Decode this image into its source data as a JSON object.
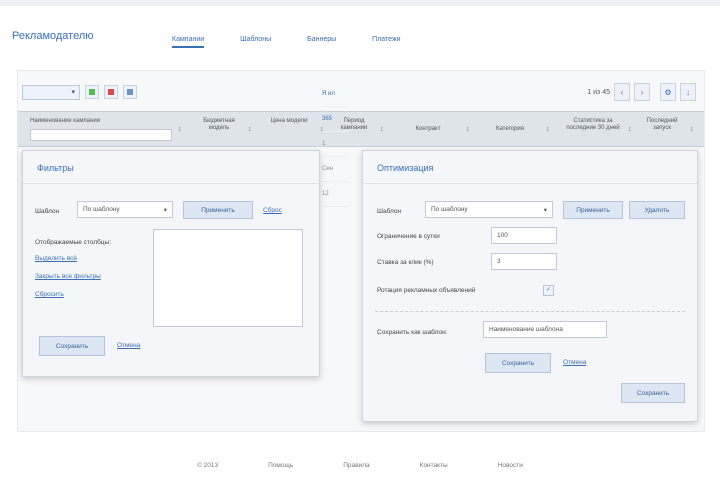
{
  "header": {
    "brand": "Рекламодателю",
    "tabs": [
      {
        "label": "Кампании",
        "active": true
      },
      {
        "label": "Шаблоны"
      },
      {
        "label": "Баннеры"
      },
      {
        "label": "Платежи"
      }
    ]
  },
  "toolbar": {
    "select_value": "",
    "pager_text": "1 из 45"
  },
  "table": {
    "columns": [
      "Наименование кампании",
      "Бюджетная модель",
      "Цена модели",
      "Период кампании",
      "Контракт",
      "Категория",
      "Статистика за последние 30 дней",
      "Последний запуск"
    ],
    "row_cells": [
      "Я ил",
      "365",
      "1",
      "Сен",
      "12"
    ]
  },
  "filter_popup": {
    "title": "Фильтры",
    "template_label": "Шаблон",
    "template_value": "По шаблону",
    "apply_button": "Применить",
    "reset_link": "Сброс",
    "visible_columns_label": "Отображаемые столбцы:",
    "links": [
      "Выделить всё",
      "Закрыть все фильтры",
      "Сбросить"
    ],
    "save_button": "Сохранить",
    "cancel_link": "Отмена"
  },
  "optimize_popup": {
    "title": "Оптимизация",
    "template_label": "Шаблон",
    "template_value": "По шаблону",
    "apply_button": "Применить",
    "delete_button": "Удалить",
    "impressions_label": "Ограничение в сутки",
    "impressions_value": "100",
    "max_cpc_label": "Ставка за клик (%)",
    "max_cpc_value": "3",
    "rotation_label": "Ротация рекламных объявлений",
    "rotation_checked": true,
    "save_template_label": "Сохранить как шаблон:",
    "save_template_placeholder": "Наименование шаблона",
    "save_template_button": "Сохранить",
    "cancel_link": "Отмена",
    "bottom_save_button": "Сохранить"
  },
  "footer": {
    "links": [
      "© 2013",
      "Помощь",
      "Правила",
      "Контакты",
      "Новости"
    ]
  },
  "colors": {
    "accent": "#3a6fb8",
    "green": "#4cc24a",
    "red": "#d94a4a",
    "blue": "#3a6fb8"
  }
}
